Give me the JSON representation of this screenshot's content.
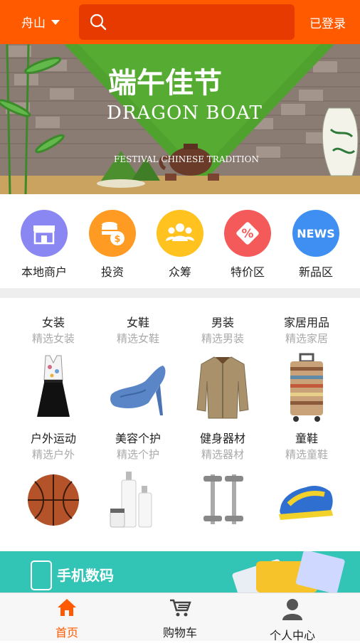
{
  "header": {
    "city": "舟山",
    "login_label": "已登录",
    "icons": [
      "chevron-down-icon",
      "search-icon"
    ]
  },
  "banner": {
    "big_title": "端午佳节",
    "title": "DRAGON BOAT",
    "subtitle": "FESTIVAL CHINESE TRADITION"
  },
  "categories": [
    {
      "label": "本地商户",
      "icon": "storefront-icon",
      "color": "#8a86f2"
    },
    {
      "label": "投资",
      "icon": "coins-icon",
      "color": "#ff9a22"
    },
    {
      "label": "众筹",
      "icon": "group-icon",
      "color": "#ffc21e"
    },
    {
      "label": "特价区",
      "icon": "percent-icon",
      "color": "#f45a5a"
    },
    {
      "label": "新品区",
      "icon": "news-icon",
      "color": "#3f8ff2",
      "badge": "NEWS"
    }
  ],
  "products": [
    {
      "title": "女装",
      "subtitle": "精选女装",
      "icon": "dress-icon"
    },
    {
      "title": "女鞋",
      "subtitle": "精选女鞋",
      "icon": "high-heel-icon"
    },
    {
      "title": "男装",
      "subtitle": "精选男装",
      "icon": "jacket-icon"
    },
    {
      "title": "家居用品",
      "subtitle": "精选家居",
      "icon": "suitcase-icon"
    },
    {
      "title": "户外运动",
      "subtitle": "精选户外",
      "icon": "basketball-icon"
    },
    {
      "title": "美容个护",
      "subtitle": "精选个护",
      "icon": "cosmetics-icon"
    },
    {
      "title": "健身器材",
      "subtitle": "精选器材",
      "icon": "dumbbell-icon"
    },
    {
      "title": "童鞋",
      "subtitle": "精选童鞋",
      "icon": "sneaker-icon"
    }
  ],
  "promo": {
    "text": "手机数码"
  },
  "bottom_nav": [
    {
      "label": "首页",
      "icon": "home-icon",
      "active": true
    },
    {
      "label": "购物车",
      "icon": "cart-icon",
      "active": false
    },
    {
      "label": "个人中心",
      "icon": "person-icon",
      "active": false
    }
  ],
  "colors": {
    "brand": "#ff5a00",
    "search_bg": "#e73a00",
    "active_nav": "#ff5a00",
    "promo_bg": "#32c4b4"
  }
}
